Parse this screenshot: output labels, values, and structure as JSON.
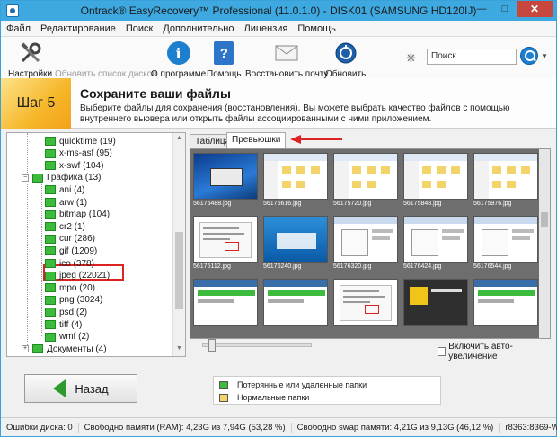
{
  "window": {
    "title": "Ontrack® EasyRecovery™ Professional (11.0.1.0) - DISK01 (SAMSUNG HD120IJ)"
  },
  "menu": [
    "Файл",
    "Редактирование",
    "Поиск",
    "Дополнительно",
    "Лицензия",
    "Помощь"
  ],
  "toolbar": {
    "settings": "Настройки",
    "refresh_disks": "Обновить список дисков",
    "about": "О программе",
    "help": "Помощь",
    "restore_mail": "Восстановить почту",
    "update": "Обновить"
  },
  "search": {
    "placeholder": "Поиск"
  },
  "step": {
    "badge": "Шаг 5",
    "title": "Сохраните ваши файлы",
    "description": "Выберите файлы для сохранения (восстановления). Вы можете выбрать качество файлов с помощью внутреннего вьювера или открыть файлы ассоциированными с ними приложением."
  },
  "tree": {
    "items": [
      {
        "label": "quicktime (19)",
        "level": 2
      },
      {
        "label": "x-ms-asf (95)",
        "level": 2
      },
      {
        "label": "x-swf (104)",
        "level": 2
      },
      {
        "label": "Графика (13)",
        "level": 1,
        "expanded": true
      },
      {
        "label": "ani (4)",
        "level": 2
      },
      {
        "label": "arw (1)",
        "level": 2
      },
      {
        "label": "bitmap (104)",
        "level": 2
      },
      {
        "label": "cr2 (1)",
        "level": 2
      },
      {
        "label": "cur (286)",
        "level": 2
      },
      {
        "label": "gif (1209)",
        "level": 2
      },
      {
        "label": "ico (378)",
        "level": 2
      },
      {
        "label": "jpeg (22021)",
        "level": 2,
        "selected": true
      },
      {
        "label": "mpo (20)",
        "level": 2
      },
      {
        "label": "png (3024)",
        "level": 2
      },
      {
        "label": "psd (2)",
        "level": 2
      },
      {
        "label": "tiff (4)",
        "level": 2
      },
      {
        "label": "wmf (2)",
        "level": 2
      },
      {
        "label": "Документы (4)",
        "level": 1,
        "expanded": false
      }
    ]
  },
  "viewer": {
    "tabs": [
      "Таблица",
      "Превьюшки"
    ],
    "active_tab": "Превьюшки",
    "thumbnails": [
      {
        "name": "56175488.jpg",
        "style": "win"
      },
      {
        "name": "56175616.jpg",
        "style": "explorer"
      },
      {
        "name": "56175720.jpg",
        "style": "explorer"
      },
      {
        "name": "56175848.jpg",
        "style": "explorer"
      },
      {
        "name": "56175976.jpg",
        "style": "explorer"
      },
      {
        "name": "56176112.jpg",
        "style": "doc"
      },
      {
        "name": "56176240.jpg",
        "style": "blue"
      },
      {
        "name": "56176320.jpg",
        "style": "dialog"
      },
      {
        "name": "56176424.jpg",
        "style": "dialog"
      },
      {
        "name": "56176544.jpg",
        "style": "dialog"
      },
      {
        "name": "",
        "style": "app"
      },
      {
        "name": "",
        "style": "app"
      },
      {
        "name": "",
        "style": "doc"
      },
      {
        "name": "",
        "style": "dark"
      },
      {
        "name": "",
        "style": "app"
      }
    ],
    "auto_zoom_label": "Включить авто-увеличение",
    "auto_zoom_checked": false
  },
  "footer": {
    "back_label": "Назад",
    "legend": [
      {
        "label": "Потерянные или удаленные папки",
        "color": "#3dbb3d"
      },
      {
        "label": "Нормальные папки",
        "color": "#f2d46a"
      }
    ]
  },
  "status": {
    "disk_errors": "Ошибки диска: 0",
    "ram": "Свободно памяти (RAM): 4,23G из 7,94G (53,28 %)",
    "swap": "Свободно swap памяти: 4,21G из 9,13G (46,12 %)",
    "sectors": "r8363:8369-W"
  },
  "colors": {
    "accent": "#3ea9e0",
    "folder_green": "#3dbb3d",
    "highlight_red": "#dd2222"
  }
}
